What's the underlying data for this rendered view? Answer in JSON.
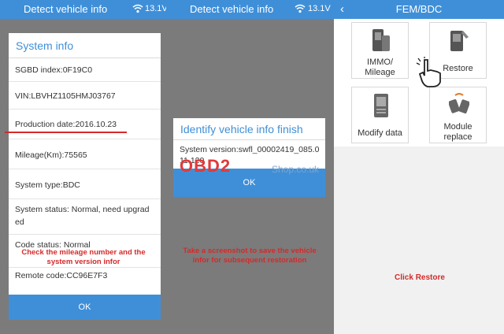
{
  "panel1": {
    "topbar_title": "Detect vehicle info",
    "signal": "13.1V",
    "dialog": {
      "title": "System info",
      "rows": [
        "SGBD index:0F19C0",
        "VIN:LBVHZ1105HMJ03767",
        "Production date:2016.10.23",
        "Mileage(Km):75565",
        "System type:BDC",
        "System status: Normal, need upgrad ed",
        "Code status: Normal",
        "Remote code:CC96E7F3"
      ],
      "ok_label": "OK"
    },
    "note": "Check the mileage number and the system version infor"
  },
  "panel2": {
    "topbar_title": "Detect vehicle info",
    "signal": "13.1V",
    "dialog": {
      "title": "Identify vehicle info finish",
      "version_text": "System version:swfl_00002419_085.0 11.120",
      "ok_label": "OK"
    },
    "watermark": "OBD2",
    "watermark_shop": "Shop.co.uk",
    "note": "Take a screenshot to save the vehicle infor for subsequent restoration"
  },
  "panel3": {
    "topbar_title": "FEM/BDC",
    "tiles": [
      {
        "label_line1": "IMMO/",
        "label_line2": "Mileage",
        "icon": "key-device-icon"
      },
      {
        "label_line1": "Restore",
        "label_line2": "",
        "icon": "wrench-device-icon"
      },
      {
        "label_line1": "Modify data",
        "label_line2": "",
        "icon": "module-icon"
      },
      {
        "label_line1": "Module",
        "label_line2": "replace",
        "icon": "swap-module-icon"
      }
    ],
    "note": "Click Restore"
  },
  "colors": {
    "accent": "#3f8fd8",
    "annotation": "#d42a2a"
  }
}
